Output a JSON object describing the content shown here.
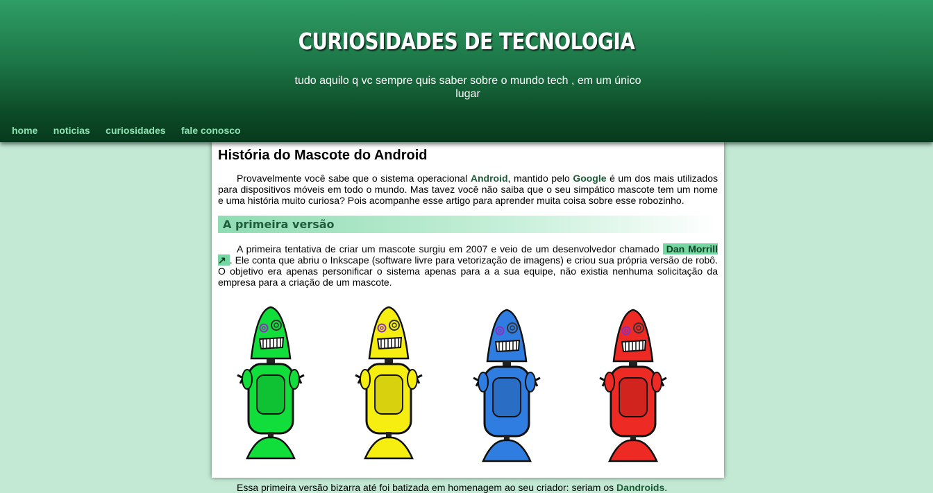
{
  "header": {
    "title": "CURIOSIDADES DE TECNOLOGIA",
    "subtitle": "tudo aquilo q vc sempre quis saber sobre o mundo tech , em um único lugar"
  },
  "nav": {
    "items": [
      "home",
      "noticias",
      "curiosidades",
      "fale conosco"
    ]
  },
  "article": {
    "title": "História do Mascote do Android",
    "p1": {
      "a": "Provavelmente você sabe que o sistema operacional ",
      "b": "Android",
      "c": ", mantido pelo ",
      "d": "Google",
      "e": " é um dos mais utilizados para dispositivos móveis em todo o mundo. Mas tavez você não saiba que o seu simpático mascote tem um nome e uma história muito curiosa? Pois acompanhe esse artigo para aprender muita coisa sobre esse robozinho."
    },
    "section_title": "A primeira versão",
    "p2": {
      "a": "A primeira tentativa de criar um mascote surgiu em 2007 e veio de um desenvolvedor chamado ",
      "link": "Dan Morrill ↗",
      "b": ". Ele conta que abriu o Inkscape (software livre para vetorização de imagens) e criou sua própria versão de robô. O objetivo era apenas personificar o sistema apenas para a a sua equipe, não existia nenhuma solicitação da empresa para a criação de um mascote."
    },
    "p3": {
      "a": "Essa primeira versão bizarra até foi batizada em homenagem ao seu criador: seriam os ",
      "b": "Dandroids",
      "c": "."
    }
  },
  "colors": {
    "page_bg": "#c3e9d5",
    "header_top": "#2f9e66",
    "header_bottom": "#073a1d",
    "nav_link": "#8ee3b4",
    "robots": [
      "#11dd3b",
      "#f5ee10",
      "#2f7de0",
      "#ee2a24"
    ]
  }
}
